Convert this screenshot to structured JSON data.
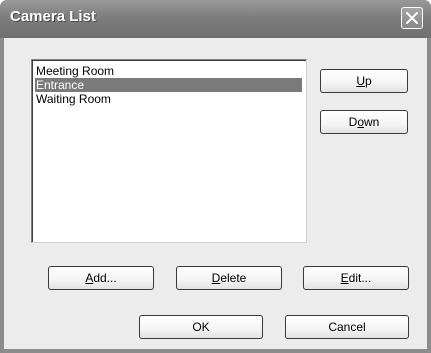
{
  "window": {
    "title": "Camera List"
  },
  "cameras": [
    {
      "label": "Meeting Room",
      "selected": false
    },
    {
      "label": "Entrance",
      "selected": true
    },
    {
      "label": "Waiting Room",
      "selected": false
    }
  ],
  "buttons": {
    "up": {
      "mnemonic": "U",
      "rest": "p"
    },
    "down": {
      "pre": "D",
      "mnemonic": "o",
      "rest": "wn"
    },
    "add": {
      "mnemonic": "A",
      "rest": "dd..."
    },
    "delete": {
      "mnemonic": "D",
      "rest": "elete"
    },
    "edit": {
      "mnemonic": "E",
      "rest": "dit..."
    },
    "ok": "OK",
    "cancel": "Cancel"
  },
  "colors": {
    "selection": "#7a7a7a",
    "titlebar": "#7d7d7d",
    "face": "#ececec"
  },
  "icons": {
    "close": "close-icon"
  }
}
